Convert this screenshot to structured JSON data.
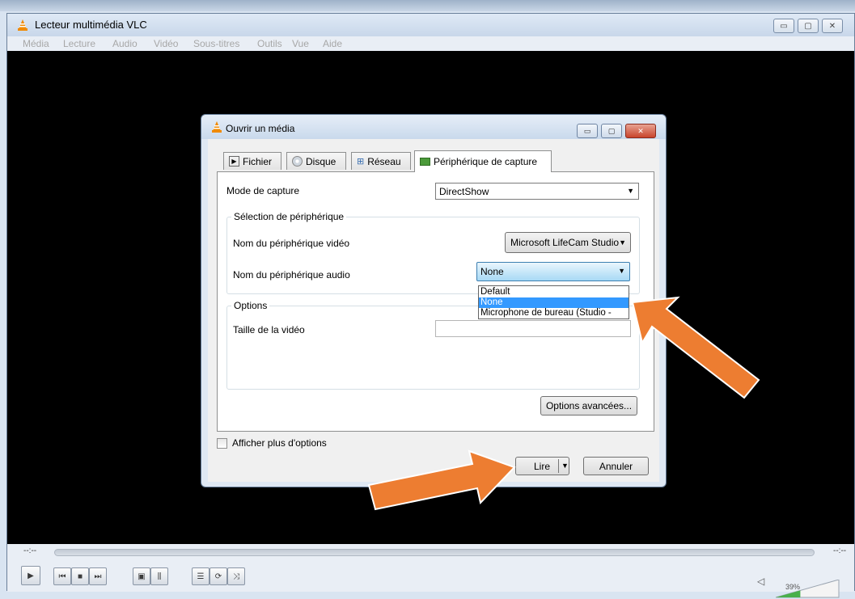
{
  "window": {
    "title": "Lecteur multimédia VLC",
    "menu": [
      "Média",
      "Lecture",
      "Audio",
      "Vidéo",
      "Sous-titres",
      "Outils",
      "Vue",
      "Aide"
    ]
  },
  "player": {
    "time_elapsed": "--:--",
    "time_total": "--:--",
    "volume_label": "39%",
    "volume_level_percent": 39
  },
  "dialog": {
    "title": "Ouvrir un média",
    "tabs": [
      {
        "label": "Fichier",
        "icon": "play-file-icon"
      },
      {
        "label": "Disque",
        "icon": "disc-icon"
      },
      {
        "label": "Réseau",
        "icon": "network-icon"
      },
      {
        "label": "Périphérique de capture",
        "icon": "capture-device-icon",
        "active": true
      }
    ],
    "capture_mode": {
      "label": "Mode de capture",
      "value": "DirectShow"
    },
    "device_group": {
      "title": "Sélection de périphérique",
      "video_label": "Nom du périphérique vidéo",
      "video_value": "Microsoft LifeCam Studio",
      "audio_label": "Nom du périphérique audio",
      "audio_value": "None",
      "audio_options": [
        "Default",
        "None",
        "Microphone de bureau (Studio -"
      ],
      "audio_selected_index": 1
    },
    "options_group": {
      "title": "Options",
      "video_size_label": "Taille de la vidéo",
      "video_size_value": ""
    },
    "advanced_button": "Options avancées...",
    "show_more_label": "Afficher plus d'options",
    "show_more_checked": false,
    "play_button": "Lire",
    "cancel_button": "Annuler"
  },
  "colors": {
    "annotation_arrow": "#ed7d31",
    "vlc_orange": "#f08a00",
    "selection_blue": "#3399ff"
  }
}
